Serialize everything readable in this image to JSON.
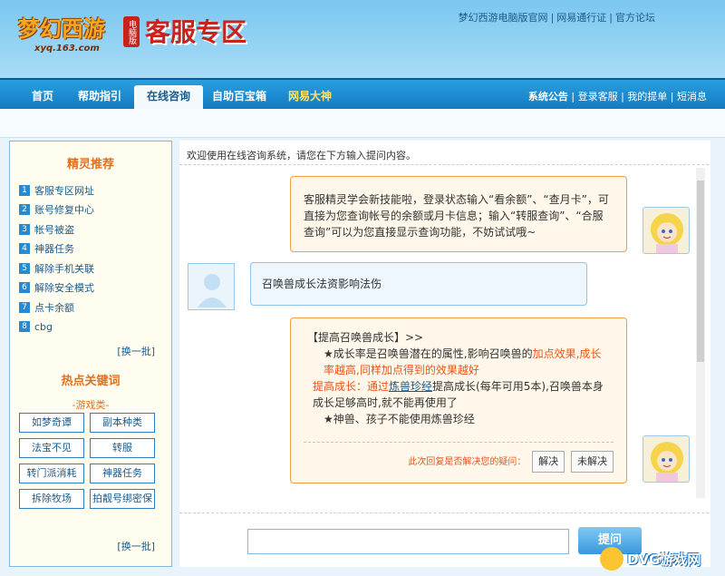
{
  "header": {
    "logo_text": "梦幻西游",
    "logo_badge": "电脑版",
    "logo_sub": "xyq.163.com",
    "site_title": "客服专区",
    "top_links": [
      "梦幻西游电脑版官网",
      "网易通行证",
      "官方论坛"
    ]
  },
  "nav": {
    "items": [
      "首页",
      "帮助指引",
      "在线咨询",
      "自助百宝箱",
      "网易大神"
    ],
    "active": "在线咨询",
    "right_links": [
      "系统公告",
      "登录客服",
      "我的提单",
      "短消息"
    ]
  },
  "sidebar": {
    "recommend_title": "精灵推荐",
    "recommend_items": [
      {
        "num": "1",
        "label": "客服专区网址"
      },
      {
        "num": "2",
        "label": "账号修复中心"
      },
      {
        "num": "3",
        "label": "帐号被盗"
      },
      {
        "num": "4",
        "label": "神器任务"
      },
      {
        "num": "5",
        "label": "解除手机关联"
      },
      {
        "num": "6",
        "label": "解除安全模式"
      },
      {
        "num": "7",
        "label": "点卡余额"
      },
      {
        "num": "8",
        "label": "cbg"
      }
    ],
    "swap_label": "[换一批]",
    "hot_title": "热点关键词",
    "hot_category": "-游戏类-",
    "keywords": [
      "如梦奇谭",
      "副本种类",
      "法宝不见",
      "转服",
      "转门派消耗",
      "神器任务",
      "拆除牧场",
      "拍靓号绑密保"
    ],
    "swap_label2": "[换一批]"
  },
  "chat": {
    "welcome": "欢迎使用在线咨询系统，请您在下方输入提问内容。",
    "msg1": "客服精灵学会新技能啦，登录状态输入“看余额”、“查月卡”，可直接为您查询帐号的余额或月卡信息；输入“转服查询”、“合服查询”可以为您直接显示查询功能，不妨试试哦~",
    "user_msg": "召唤兽成长法资影响法伤",
    "reply_title": "【提高召唤兽成长】>>",
    "reply_line1_a": "★成长率是召唤兽潜在的属性,影响召唤兽的",
    "reply_line1_b": "加点效果,成长率越高,同样加点得到的效果越好",
    "reply_line2_a": "提高成长：通过",
    "reply_line2_link": "炼兽珍经",
    "reply_line2_b": "提高成长(每年可用5本),召唤兽本身成长足够高时,就不能再使用了",
    "reply_line3": "★神兽、孩子不能使用炼兽珍经",
    "feedback_q": "此次回复是否解决您的疑问：",
    "btn_solved": "解决",
    "btn_unsolved": "未解决"
  },
  "input": {
    "send_label": "提问"
  },
  "watermark": {
    "text": "DVG游戏网"
  },
  "colors": {
    "nav_blue": "#137ac2",
    "accent_orange": "#e0701e",
    "title_red": "#c9231b"
  }
}
